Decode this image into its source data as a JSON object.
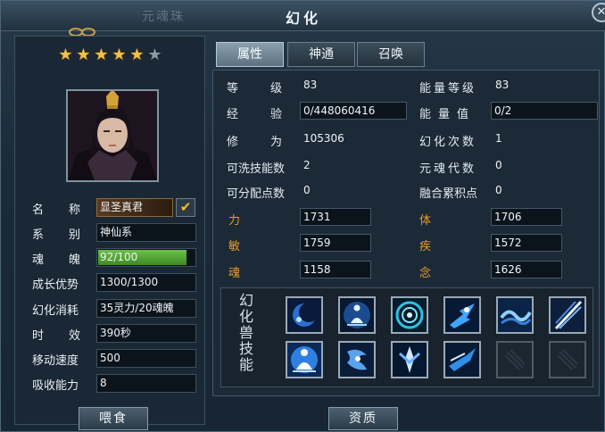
{
  "window": {
    "title": "幻化",
    "ghost_title": "元魂珠",
    "close_icon": "close-icon"
  },
  "stars": {
    "filled": 5,
    "total": 6
  },
  "tabs": [
    {
      "label": "属性",
      "active": true
    },
    {
      "label": "神通",
      "active": false
    },
    {
      "label": "召唤",
      "active": false
    }
  ],
  "left": {
    "name": {
      "label_a": "名",
      "label_b": "称",
      "value": "显圣真君"
    },
    "type": {
      "label_a": "系",
      "label_b": "别",
      "value": "神仙系"
    },
    "soul": {
      "label_a": "魂",
      "label_b": "魄",
      "value": "92/100",
      "fraction": 0.92
    },
    "growth": {
      "label": "成长优势",
      "value": "1300/1300"
    },
    "cost": {
      "label": "幻化消耗",
      "value": "35灵力/20魂魄"
    },
    "duration": {
      "label_a": "时",
      "label_b": "效",
      "value": "390秒"
    },
    "speed": {
      "label": "移动速度",
      "value": "500"
    },
    "absorb": {
      "label": "吸收能力",
      "value": "8"
    }
  },
  "attrs": {
    "level": {
      "label_a": "等",
      "label_b": "级",
      "value": "83"
    },
    "energy_level": {
      "label": "能量等级",
      "value": "83"
    },
    "exp": {
      "label_a": "经",
      "label_b": "验",
      "value": "0/448060416"
    },
    "energy_value": {
      "label": "能量值",
      "value": "0/2"
    },
    "cultivation": {
      "label_a": "修",
      "label_b": "为",
      "value": "105306"
    },
    "transform_count": {
      "label": "幻化次数",
      "value": "1"
    },
    "washable_skills": {
      "label": "可洗技能数",
      "value": "2"
    },
    "soul_generation": {
      "label": "元魂代数",
      "value": "0"
    },
    "assignable_points": {
      "label": "可分配点数",
      "value": "0"
    },
    "fusion_points": {
      "label": "融合累积点",
      "value": "0"
    },
    "strength": {
      "label": "力",
      "value": "1731"
    },
    "body": {
      "label": "体",
      "value": "1706"
    },
    "agility": {
      "label": "敏",
      "value": "1759"
    },
    "swift": {
      "label": "疾",
      "value": "1572"
    },
    "soul": {
      "label": "魂",
      "value": "1158"
    },
    "mind": {
      "label": "念",
      "value": "1626"
    }
  },
  "skills": {
    "title": [
      "幻",
      "化",
      "兽",
      "技",
      "能"
    ],
    "icons": [
      "moon-skill-icon",
      "meditate-skill-icon",
      "vortex-skill-icon",
      "dash-skill-icon",
      "wave-skill-icon",
      "slash-skill-icon",
      "buddha-skill-icon",
      "storm-skill-icon",
      "spirit-skill-icon",
      "strike-skill-icon",
      "empty-slot-icon",
      "empty-slot-icon"
    ]
  },
  "buttons": {
    "feed": "喂食",
    "aptitude": "资质"
  },
  "colors": {
    "accent_orange": "#e89a2c",
    "star_gold": "#f2c14a",
    "bar_green": "#5aa83a"
  }
}
